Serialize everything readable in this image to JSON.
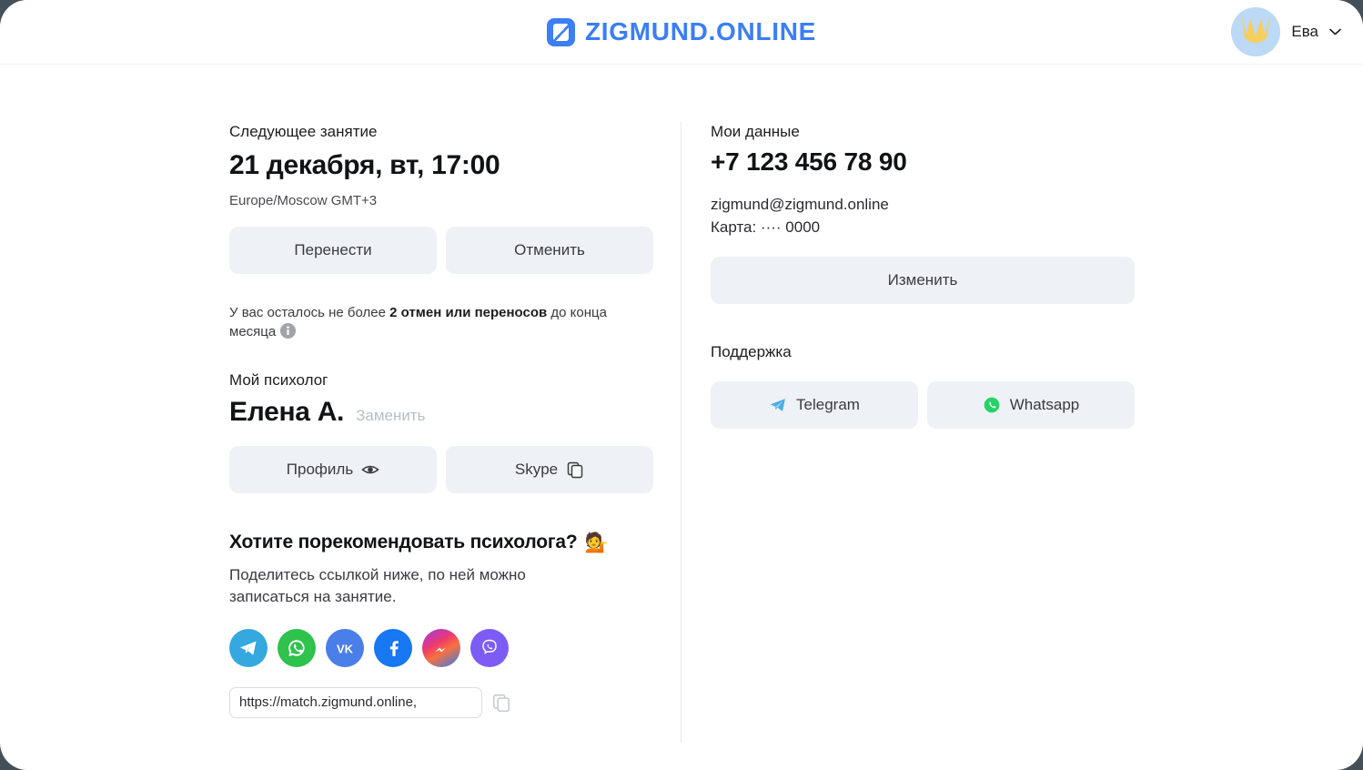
{
  "header": {
    "brand_name": "ZIGMUND.ONLINE",
    "brand_color": "#3b7ef5",
    "logo_icon": "zigmund-logo-icon",
    "user_name": "Ева",
    "avatar_icon": "user-avatar",
    "chevron_icon": "chevron-down-icon"
  },
  "next_session": {
    "label": "Следующее занятие",
    "datetime": "21 декабря, вт, 17:00",
    "timezone": "Europe/Moscow GMT+3",
    "reschedule_label": "Перенести",
    "cancel_label": "Отменить"
  },
  "notice": {
    "prefix": "У вас осталось не более ",
    "strong": "2 отмен или переносов",
    "suffix": " до конца месяца",
    "info_icon": "info-icon"
  },
  "psychologist": {
    "label": "Мой психолог",
    "name": "Елена А.",
    "replace_label": "Заменить",
    "profile_label": "Профиль",
    "profile_icon": "eye-icon",
    "skype_label": "Skype",
    "skype_icon": "copy-icon"
  },
  "referral": {
    "title": "Хотите порекомендовать психолога?",
    "title_emoji": "💁",
    "description": "Поделитесь ссылкой ниже, по ней можно записаться на занятие.",
    "socials": [
      {
        "name": "telegram",
        "label": "Telegram",
        "icon": "telegram-icon",
        "color": "#35a8df"
      },
      {
        "name": "whatsapp",
        "label": "WhatsApp",
        "icon": "whatsapp-icon",
        "color": "#2fc24d"
      },
      {
        "name": "vk",
        "label": "VK",
        "icon": "vk-icon",
        "color": "#4a7ee8"
      },
      {
        "name": "facebook",
        "label": "Facebook",
        "icon": "facebook-icon",
        "color": "#1877f2"
      },
      {
        "name": "messenger",
        "label": "Messenger",
        "icon": "messenger-icon",
        "color": "#ed3a6d"
      },
      {
        "name": "viber",
        "label": "Viber",
        "icon": "viber-icon",
        "color": "#7d5cf5"
      }
    ],
    "link_value": "https://match.zigmund.online,",
    "copy_icon": "copy-icon"
  },
  "my_data": {
    "label": "Мои данные",
    "phone": "+7 123 456 78 90",
    "email": "zigmund@zigmund.online",
    "card": "Карта: ···· 0000",
    "edit_label": "Изменить"
  },
  "support": {
    "label": "Поддержка",
    "telegram_label": "Telegram",
    "telegram_icon": "telegram-icon",
    "whatsapp_label": "Whatsapp",
    "whatsapp_icon": "whatsapp-icon"
  }
}
